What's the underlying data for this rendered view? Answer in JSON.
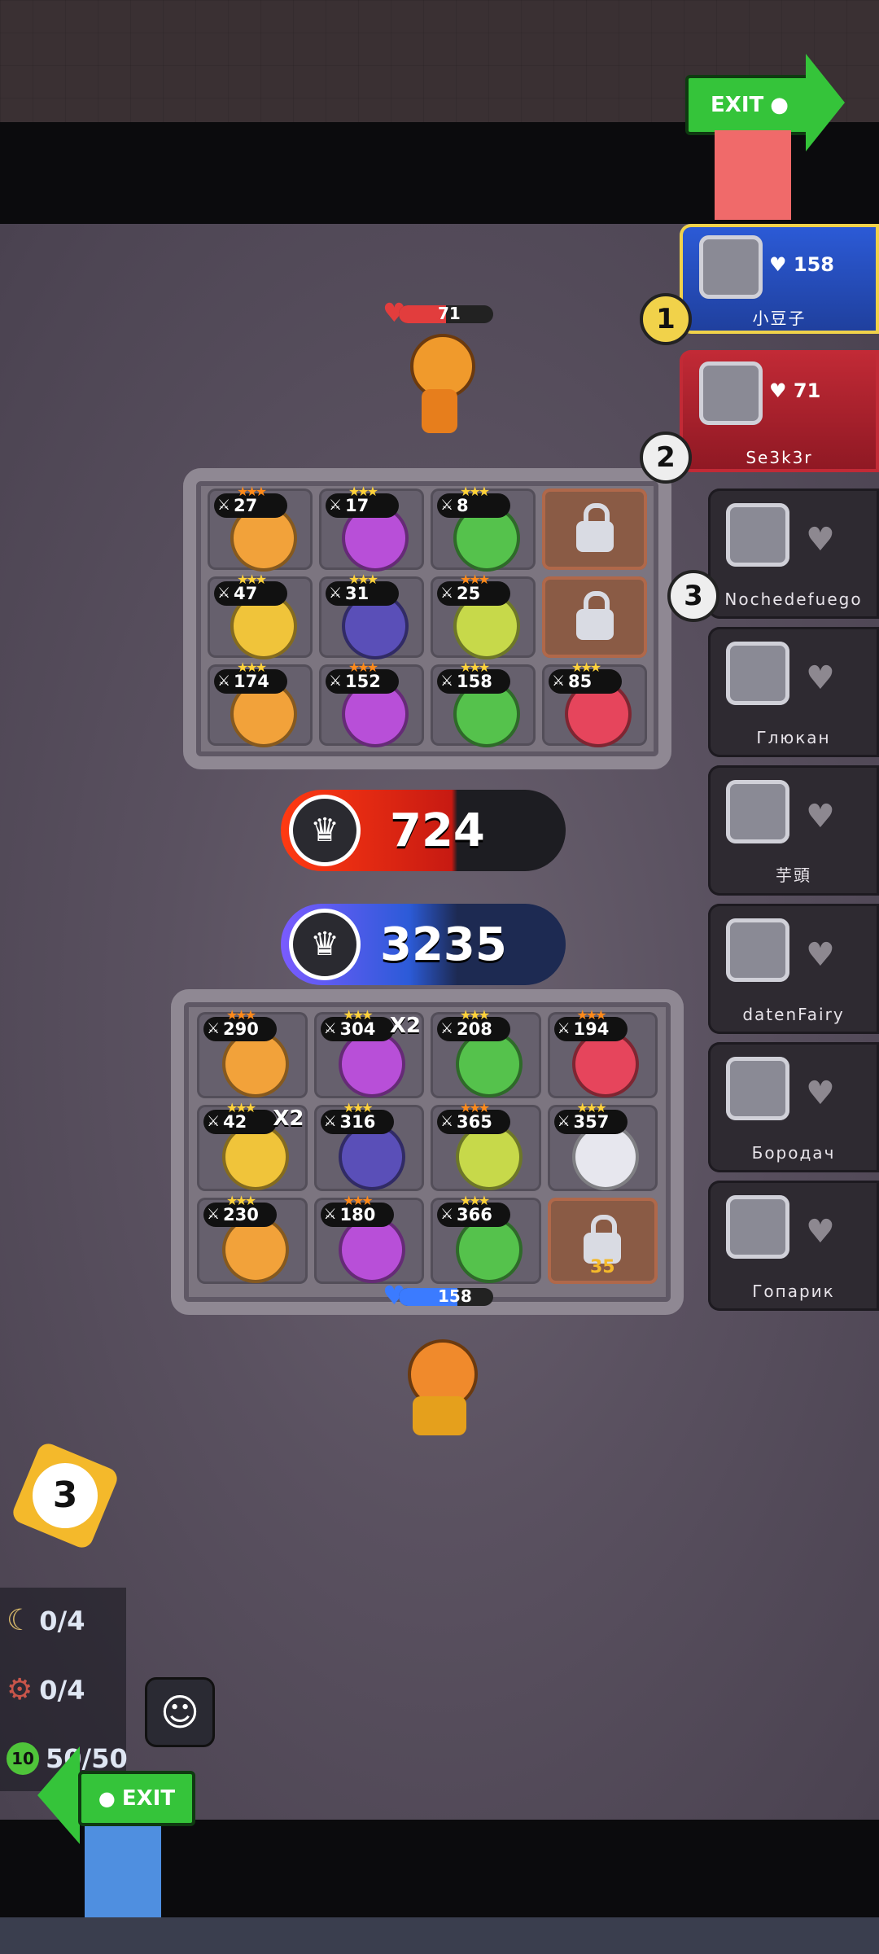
{
  "opponent": {
    "hp": "71",
    "hp_fraction": 0.5
  },
  "player_board": {
    "shield": "158",
    "shield_fraction": 0.62
  },
  "scores": {
    "opponent_power": "724",
    "player_power": "3235"
  },
  "exit": {
    "top_label": "EXIT",
    "bottom_label": "EXIT"
  },
  "leaderboard": [
    {
      "rank": "1",
      "hp": "158",
      "name": "小豆子",
      "highlight": "#f1d24a"
    },
    {
      "rank": "2",
      "hp": "71",
      "name": "Se3k3r",
      "highlight": "#c22a36"
    },
    {
      "rank": "3",
      "name": "Nochedefuego"
    },
    {
      "name": "Глюкан"
    },
    {
      "name": "芋頭"
    },
    {
      "name": "datenFairy"
    },
    {
      "name": "Бородач"
    },
    {
      "name": "Гопарик"
    }
  ],
  "opponent_units": [
    {
      "power": "27"
    },
    {
      "power": "17"
    },
    {
      "power": "8"
    },
    {
      "locked": true
    },
    {
      "power": "47"
    },
    {
      "power": "31"
    },
    {
      "power": "25"
    },
    {
      "locked": true
    },
    {
      "power": "174"
    },
    {
      "power": "152"
    },
    {
      "power": "158"
    },
    {
      "power": "85"
    }
  ],
  "player_units": [
    {
      "power": "290"
    },
    {
      "power": "304",
      "multiplier": "X2"
    },
    {
      "power": "208"
    },
    {
      "power": "194"
    },
    {
      "power": "42",
      "multiplier": "X2"
    },
    {
      "power": "316"
    },
    {
      "power": "365"
    },
    {
      "power": "357"
    },
    {
      "power": "230"
    },
    {
      "power": "180"
    },
    {
      "power": "366"
    },
    {
      "locked": true,
      "unlock_level": "35"
    }
  ],
  "round_level": "3",
  "resources": {
    "moon": "0/4",
    "gear": "0/4",
    "coins_level": "10",
    "coins": "50/50"
  },
  "colors": {
    "player_blue": "#2c5bd8",
    "opponent_red": "#e23d3d",
    "exit_green": "#35c43a"
  }
}
